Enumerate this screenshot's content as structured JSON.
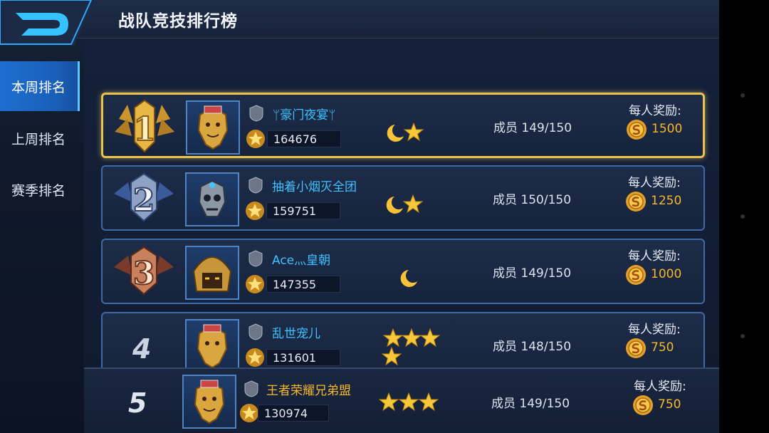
{
  "header": {
    "title": "战队竞技排行榜",
    "back_icon": "back-arrow-icon"
  },
  "tabs": [
    {
      "label": "本周排名",
      "active": true
    },
    {
      "label": "上周排名",
      "active": false
    },
    {
      "label": "赛季排名",
      "active": false
    }
  ],
  "teams": [
    {
      "rank": "1",
      "name": "ᛘ豪门夜宴ᛘ",
      "score": "164676",
      "tier": "moon-star-star",
      "members": "成员 149/150",
      "reward_label": "每人奖励:",
      "reward": "1500"
    },
    {
      "rank": "2",
      "name": "抽着小烟灭全团",
      "score": "159751",
      "tier": "moon-star-star",
      "members": "成员 150/150",
      "reward_label": "每人奖励:",
      "reward": "1250"
    },
    {
      "rank": "3",
      "name": "Ace灬皇朝",
      "score": "147355",
      "tier": "moon",
      "members": "成员 149/150",
      "reward_label": "每人奖励:",
      "reward": "1000"
    },
    {
      "rank": "4",
      "name": "乱世宠儿",
      "score": "131601",
      "tier": "4-stars",
      "members": "成员 148/150",
      "reward_label": "每人奖励:",
      "reward": "750"
    }
  ],
  "own_team": {
    "rank": "5",
    "name": "王者荣耀兄弟盟",
    "score": "130974",
    "tier": "3-stars",
    "members": "成员 149/150",
    "reward_label": "每人奖励:",
    "reward": "750"
  },
  "colors": {
    "gold_border": "#e9c34f",
    "name_blue": "#3fc2ff",
    "name_gold": "#f5b82b",
    "reward_gold": "#f5b82b",
    "tab_active": "#1e6fd0"
  }
}
